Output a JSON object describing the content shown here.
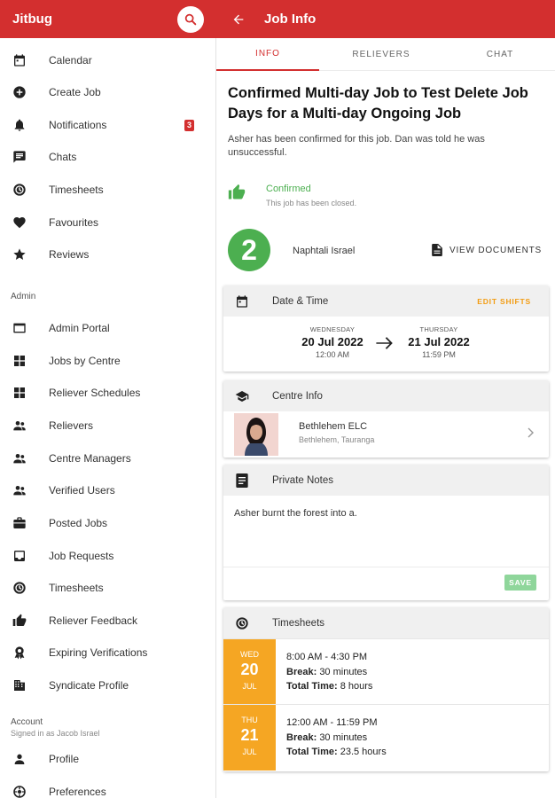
{
  "app": {
    "title": "Jitbug",
    "page_title": "Job Info"
  },
  "drawer": {
    "main_items": [
      {
        "label": "Calendar",
        "icon": "calendar-icon"
      },
      {
        "label": "Create Job",
        "icon": "add-circle-icon"
      },
      {
        "label": "Notifications",
        "icon": "bell-icon",
        "badge": "3"
      },
      {
        "label": "Chats",
        "icon": "chat-icon"
      },
      {
        "label": "Timesheets",
        "icon": "timesheet-icon"
      },
      {
        "label": "Favourites",
        "icon": "heart-icon"
      },
      {
        "label": "Reviews",
        "icon": "star-icon"
      }
    ],
    "admin_label": "Admin",
    "admin_items": [
      {
        "label": "Admin Portal",
        "icon": "portal-icon"
      },
      {
        "label": "Jobs by Centre",
        "icon": "grid-icon"
      },
      {
        "label": "Reliever Schedules",
        "icon": "grid-icon"
      },
      {
        "label": "Relievers",
        "icon": "people-icon"
      },
      {
        "label": "Centre Managers",
        "icon": "people-icon"
      },
      {
        "label": "Verified Users",
        "icon": "people-icon"
      },
      {
        "label": "Posted Jobs",
        "icon": "briefcase-icon"
      },
      {
        "label": "Job Requests",
        "icon": "inbox-icon"
      },
      {
        "label": "Timesheets",
        "icon": "timesheet-icon"
      },
      {
        "label": "Reliever Feedback",
        "icon": "thumbs-up-icon"
      },
      {
        "label": "Expiring Verifications",
        "icon": "award-icon"
      },
      {
        "label": "Syndicate Profile",
        "icon": "building-icon"
      }
    ],
    "account_label": "Account",
    "account_sub": "Signed in as Jacob Israel",
    "account_items": [
      {
        "label": "Profile",
        "icon": "person-icon"
      },
      {
        "label": "Preferences",
        "icon": "settings-icon"
      }
    ]
  },
  "tabs": [
    "INFO",
    "RELIEVERS",
    "CHAT"
  ],
  "job": {
    "title": "Confirmed Multi-day Job to Test Delete Job Days for a Multi-day Ongoing Job",
    "description": "Asher has been confirmed for this job. Dan was told he was unsuccessful.",
    "status": "Confirmed",
    "status_sub": "This job has been closed.",
    "reliever_number": "2",
    "reliever_name": "Naphtali Israel",
    "view_documents": "VIEW DOCUMENTS"
  },
  "date_time": {
    "title": "Date & Time",
    "edit_label": "EDIT SHIFTS",
    "start": {
      "dow": "WEDNESDAY",
      "date": "20 Jul 2022",
      "time": "12:00 AM"
    },
    "end": {
      "dow": "THURSDAY",
      "date": "21 Jul 2022",
      "time": "11:59 PM"
    }
  },
  "centre": {
    "title": "Centre Info",
    "name": "Bethlehem ELC",
    "location": "Bethlehem, Tauranga"
  },
  "notes": {
    "title": "Private Notes",
    "text": "Asher burnt the forest into a.",
    "save_label": "SAVE"
  },
  "timesheets": {
    "title": "Timesheets",
    "break_label": "Break:",
    "total_label": "Total Time:",
    "rows": [
      {
        "dow": "WED",
        "day": "20",
        "month": "JUL",
        "hours": "8:00 AM - 4:30 PM",
        "break": "30 minutes",
        "total": "8 hours"
      },
      {
        "dow": "THU",
        "day": "21",
        "month": "JUL",
        "hours": "12:00 AM - 11:59 PM",
        "break": "30 minutes",
        "total": "23.5 hours"
      }
    ]
  },
  "colors": {
    "primary": "#d32f2f",
    "success": "#4caf50",
    "warning": "#f5a623"
  }
}
